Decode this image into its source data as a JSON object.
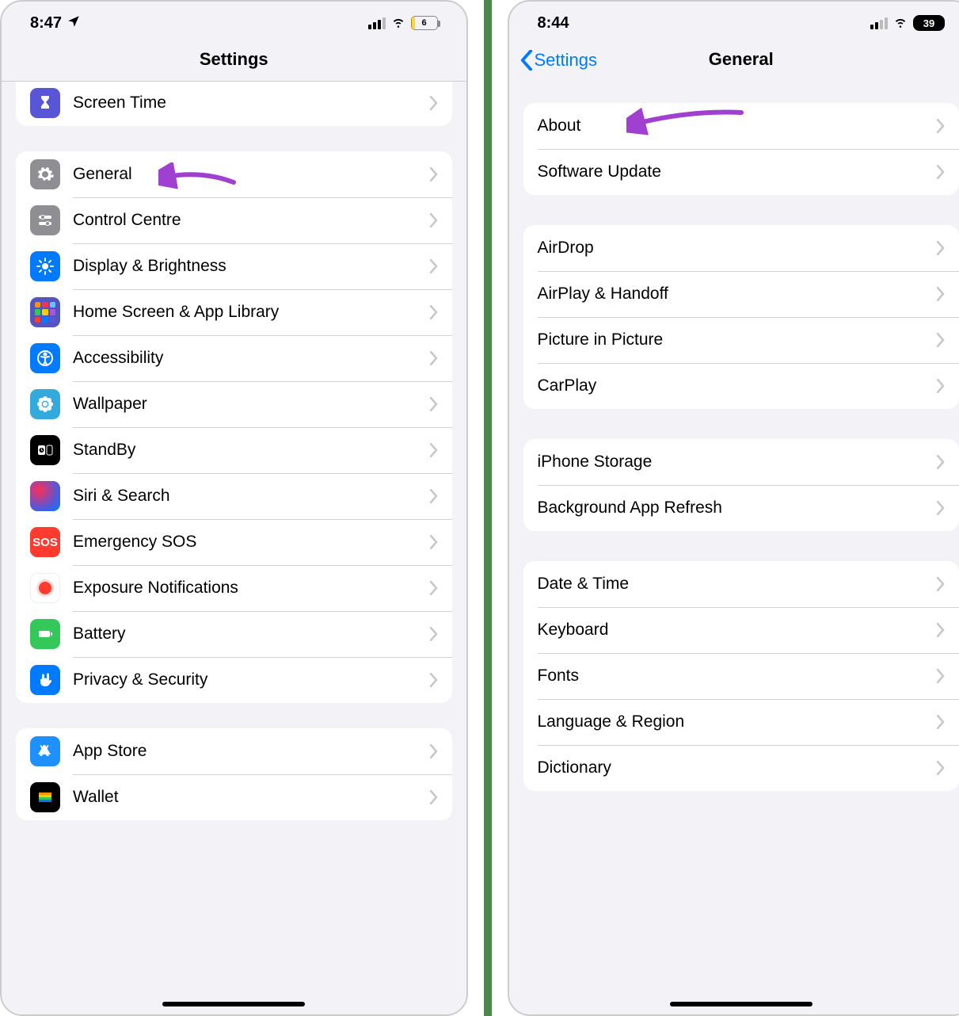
{
  "left": {
    "status": {
      "time": "8:47",
      "battery": "6"
    },
    "nav": {
      "title": "Settings"
    },
    "group_top": [
      {
        "icon": "screentime",
        "label": "Screen Time"
      }
    ],
    "group_main": [
      {
        "icon": "general",
        "label": "General"
      },
      {
        "icon": "control",
        "label": "Control Centre"
      },
      {
        "icon": "display",
        "label": "Display & Brightness"
      },
      {
        "icon": "home",
        "label": "Home Screen & App Library"
      },
      {
        "icon": "access",
        "label": "Accessibility"
      },
      {
        "icon": "wallpaper",
        "label": "Wallpaper"
      },
      {
        "icon": "standby",
        "label": "StandBy"
      },
      {
        "icon": "siri",
        "label": "Siri & Search"
      },
      {
        "icon": "sos",
        "label": "Emergency SOS"
      },
      {
        "icon": "exposure",
        "label": "Exposure Notifications"
      },
      {
        "icon": "battery",
        "label": "Battery"
      },
      {
        "icon": "privacy",
        "label": "Privacy & Security"
      }
    ],
    "group_bottom": [
      {
        "icon": "appstore",
        "label": "App Store"
      },
      {
        "icon": "wallet",
        "label": "Wallet"
      }
    ]
  },
  "right": {
    "status": {
      "time": "8:44",
      "battery": "39"
    },
    "nav": {
      "back": "Settings",
      "title": "General"
    },
    "group1": [
      {
        "label": "About"
      },
      {
        "label": "Software Update"
      }
    ],
    "group2": [
      {
        "label": "AirDrop"
      },
      {
        "label": "AirPlay & Handoff"
      },
      {
        "label": "Picture in Picture"
      },
      {
        "label": "CarPlay"
      }
    ],
    "group3": [
      {
        "label": "iPhone Storage"
      },
      {
        "label": "Background App Refresh"
      }
    ],
    "group4": [
      {
        "label": "Date & Time"
      },
      {
        "label": "Keyboard"
      },
      {
        "label": "Fonts"
      },
      {
        "label": "Language & Region"
      },
      {
        "label": "Dictionary"
      }
    ]
  },
  "sos_text": "SOS"
}
